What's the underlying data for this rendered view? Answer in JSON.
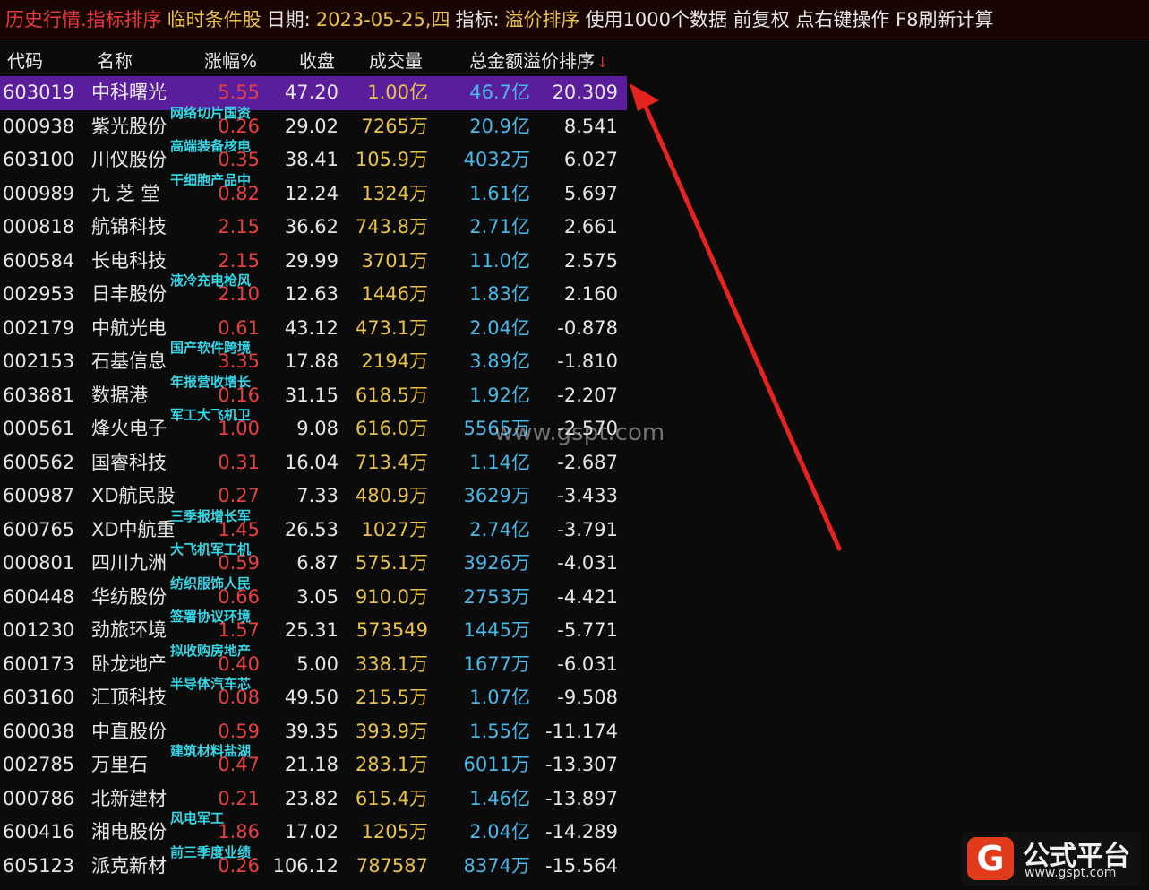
{
  "title": {
    "section": "历史行情.指标排序",
    "mode": "临时条件股",
    "date_label": "日期:",
    "date": "2023-05-25,四",
    "indicator_label": "指标:",
    "indicator": "溢价排序",
    "info": "使用1000个数据 前复权 点右键操作 F8刷新计算"
  },
  "columns": [
    "代码",
    "名称",
    "涨幅%",
    "收盘",
    "成交量",
    "总金额",
    "溢价排序"
  ],
  "sort_arrow": "↓",
  "rows": [
    {
      "code": "603019",
      "name": "中科曙光",
      "chg": "5.55",
      "close": "47.20",
      "vol": "1.00亿",
      "amt": "46.7亿",
      "prem": "20.309",
      "tag": ""
    },
    {
      "code": "000938",
      "name": "紫光股份",
      "chg": "0.26",
      "close": "29.02",
      "vol": "7265万",
      "amt": "20.9亿",
      "prem": "8.541",
      "tag": "网络切片国资"
    },
    {
      "code": "603100",
      "name": "川仪股份",
      "chg": "0.35",
      "close": "38.41",
      "vol": "105.9万",
      "amt": "4032万",
      "prem": "6.027",
      "tag": "高端装备核电"
    },
    {
      "code": "000989",
      "name": "九 芝 堂",
      "chg": "0.82",
      "close": "12.24",
      "vol": "1324万",
      "amt": "1.61亿",
      "prem": "5.697",
      "tag": "干细胞产品中"
    },
    {
      "code": "000818",
      "name": "航锦科技",
      "chg": "2.15",
      "close": "36.62",
      "vol": "743.8万",
      "amt": "2.71亿",
      "prem": "2.661",
      "tag": ""
    },
    {
      "code": "600584",
      "name": "长电科技",
      "chg": "2.15",
      "close": "29.99",
      "vol": "3701万",
      "amt": "11.0亿",
      "prem": "2.575",
      "tag": ""
    },
    {
      "code": "002953",
      "name": "日丰股份",
      "chg": "2.10",
      "close": "12.63",
      "vol": "1446万",
      "amt": "1.83亿",
      "prem": "2.160",
      "tag": "液冷充电枪风"
    },
    {
      "code": "002179",
      "name": "中航光电",
      "chg": "0.61",
      "close": "43.12",
      "vol": "473.1万",
      "amt": "2.04亿",
      "prem": "-0.878",
      "tag": ""
    },
    {
      "code": "002153",
      "name": "石基信息",
      "chg": "3.35",
      "close": "17.88",
      "vol": "2194万",
      "amt": "3.89亿",
      "prem": "-1.810",
      "tag": "国产软件跨境"
    },
    {
      "code": "603881",
      "name": "数据港",
      "chg": "0.16",
      "close": "31.15",
      "vol": "618.5万",
      "amt": "1.92亿",
      "prem": "-2.207",
      "tag": "年报营收增长"
    },
    {
      "code": "000561",
      "name": "烽火电子",
      "chg": "1.00",
      "close": "9.08",
      "vol": "616.0万",
      "amt": "5565万",
      "prem": "-2.570",
      "tag": "军工大飞机卫"
    },
    {
      "code": "600562",
      "name": "国睿科技",
      "chg": "0.31",
      "close": "16.04",
      "vol": "713.4万",
      "amt": "1.14亿",
      "prem": "-2.687",
      "tag": ""
    },
    {
      "code": "600987",
      "name": "XD航民股",
      "chg": "0.27",
      "close": "7.33",
      "vol": "480.9万",
      "amt": "3629万",
      "prem": "-3.433",
      "tag": ""
    },
    {
      "code": "600765",
      "name": "XD中航重",
      "chg": "1.45",
      "close": "26.53",
      "vol": "1027万",
      "amt": "2.74亿",
      "prem": "-3.791",
      "tag": "三季报增长军"
    },
    {
      "code": "000801",
      "name": "四川九洲",
      "chg": "0.59",
      "close": "6.87",
      "vol": "575.1万",
      "amt": "3926万",
      "prem": "-4.031",
      "tag": "大飞机军工机"
    },
    {
      "code": "600448",
      "name": "华纺股份",
      "chg": "0.66",
      "close": "3.05",
      "vol": "910.0万",
      "amt": "2753万",
      "prem": "-4.421",
      "tag": "纺织服饰人民"
    },
    {
      "code": "001230",
      "name": "劲旅环境",
      "chg": "1.57",
      "close": "25.31",
      "vol": "573549",
      "amt": "1445万",
      "prem": "-5.771",
      "tag": "签署协议环境"
    },
    {
      "code": "600173",
      "name": "卧龙地产",
      "chg": "0.40",
      "close": "5.00",
      "vol": "338.1万",
      "amt": "1677万",
      "prem": "-6.031",
      "tag": "拟收购房地产"
    },
    {
      "code": "603160",
      "name": "汇顶科技",
      "chg": "0.08",
      "close": "49.50",
      "vol": "215.5万",
      "amt": "1.07亿",
      "prem": "-9.508",
      "tag": "半导体汽车芯"
    },
    {
      "code": "600038",
      "name": "中直股份",
      "chg": "0.59",
      "close": "39.35",
      "vol": "393.9万",
      "amt": "1.55亿",
      "prem": "-11.174",
      "tag": ""
    },
    {
      "code": "002785",
      "name": "万里石",
      "chg": "0.47",
      "close": "21.18",
      "vol": "283.1万",
      "amt": "6011万",
      "prem": "-13.307",
      "tag": "建筑材料盐湖"
    },
    {
      "code": "000786",
      "name": "北新建材",
      "chg": "0.21",
      "close": "23.82",
      "vol": "615.4万",
      "amt": "1.46亿",
      "prem": "-13.897",
      "tag": ""
    },
    {
      "code": "600416",
      "name": "湘电股份",
      "chg": "1.86",
      "close": "17.02",
      "vol": "1205万",
      "amt": "2.04亿",
      "prem": "-14.289",
      "tag": "风电军工"
    },
    {
      "code": "605123",
      "name": "派克新材",
      "chg": "0.26",
      "close": "106.12",
      "vol": "787587",
      "amt": "8374万",
      "prem": "-15.564",
      "tag": "前三季度业绩"
    }
  ],
  "watermark": "www.gspt.com",
  "logo": {
    "mark": "G",
    "name": "公式平台",
    "url": "www.gspt.com"
  },
  "colors": {
    "selected_row": "#5a1d9c",
    "up": "#e84040",
    "volume": "#e8c24a",
    "amount": "#4ab8e8",
    "tag": "#36d6e6",
    "arrow": "#e52420"
  }
}
